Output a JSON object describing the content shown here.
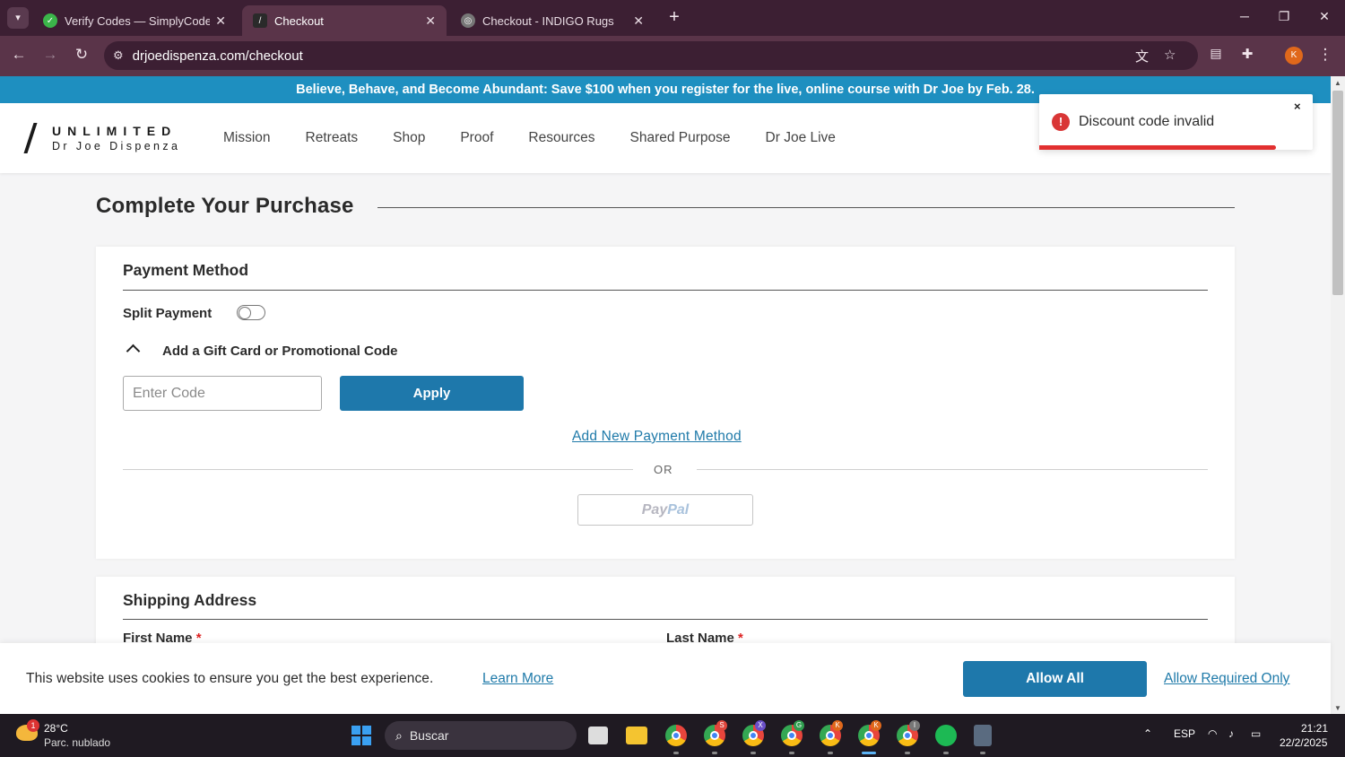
{
  "browser": {
    "tabs": [
      {
        "label": "Verify Codes — SimplyCodes",
        "favicon_color": "#3bb54a"
      },
      {
        "label": "Checkout",
        "favicon_color": "#2a2a2a"
      },
      {
        "label": "Checkout - INDIGO Rugs",
        "favicon_color": "#777777"
      }
    ],
    "url": "drjoedispenza.com/checkout",
    "profile_initial": "K"
  },
  "promo_banner": "Believe, Behave, and Become Abundant: Save $100 when you register for the live, online course with Dr Joe by Feb. 28.",
  "logo": {
    "top": "UNLIMITED",
    "bottom": "Dr Joe Dispenza"
  },
  "nav": [
    "Mission",
    "Retreats",
    "Shop",
    "Proof",
    "Resources",
    "Shared Purpose",
    "Dr Joe Live"
  ],
  "toast": {
    "message": "Discount code invalid",
    "close": "×",
    "icon": "!"
  },
  "page_title": "Complete Your Purchase",
  "payment": {
    "title": "Payment Method",
    "split_label": "Split Payment",
    "gift_label": "Add a Gift Card or Promotional Code",
    "code_placeholder": "Enter Code",
    "apply_label": "Apply",
    "add_payment_link": "Add New Payment Method",
    "or_text": "OR",
    "paypal_a": "Pay",
    "paypal_b": "Pal"
  },
  "shipping": {
    "title": "Shipping Address",
    "first_name_label": "First Name",
    "last_name_label": "Last Name",
    "required_mark": "*"
  },
  "cookie": {
    "text": "This website uses cookies to ensure you get the best experience.",
    "learn_more": "Learn More",
    "allow_all": "Allow All",
    "allow_required": "Allow Required Only"
  },
  "taskbar": {
    "weather_temp": "28°C",
    "weather_desc": "Parc. nublado",
    "weather_badge": "1",
    "search_label": "Buscar",
    "chrome_badges": [
      "S",
      "X",
      "G",
      "K",
      "K",
      "I"
    ],
    "lang": "ESP",
    "time": "21:21",
    "date": "22/2/2025"
  },
  "colors": {
    "accent": "#1e78ab",
    "promo": "#1e8fc0",
    "error": "#e23030"
  }
}
